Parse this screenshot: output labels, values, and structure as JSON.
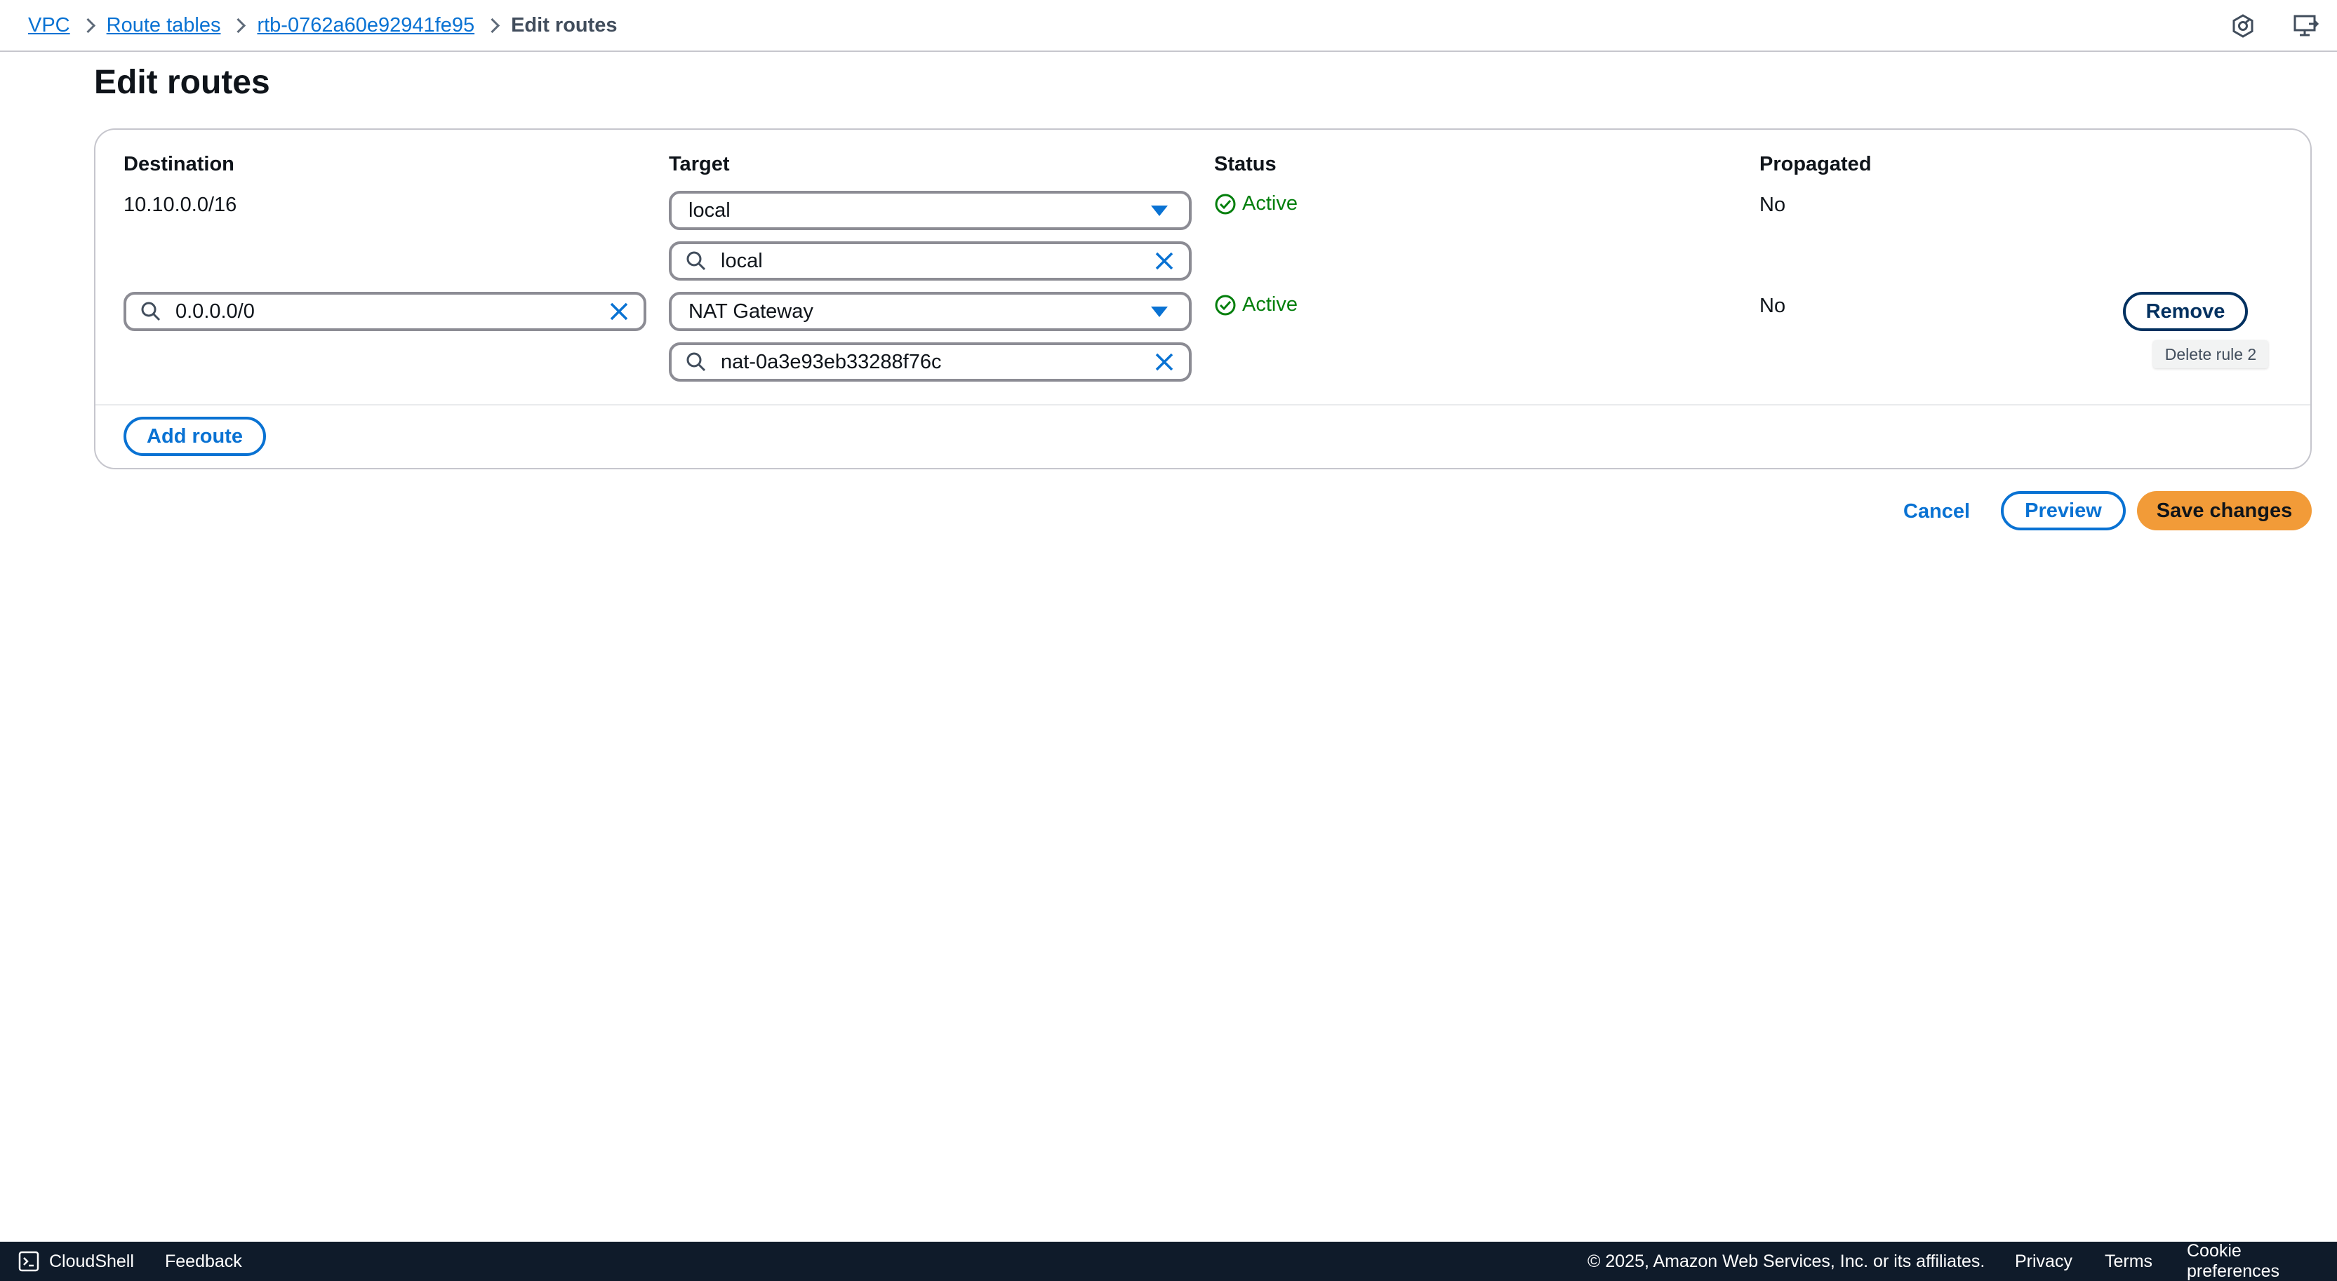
{
  "breadcrumb": {
    "items": [
      "VPC",
      "Route tables",
      "rtb-0762a60e92941fe95"
    ],
    "current": "Edit routes"
  },
  "top_icons": [
    "hexagon-settings-icon",
    "screen-share-icon"
  ],
  "page": {
    "title": "Edit routes"
  },
  "table": {
    "headers": {
      "destination": "Destination",
      "target": "Target",
      "status": "Status",
      "propagated": "Propagated"
    },
    "rows": [
      {
        "destination": "10.10.0.0/16",
        "target_type": "local",
        "target_search": "local",
        "status": "Active",
        "propagated": "No"
      },
      {
        "destination": "0.0.0.0/0",
        "target_type": "NAT Gateway",
        "target_search": "nat-0a3e93eb33288f76c",
        "status": "Active",
        "propagated": "No",
        "remove_label": "Remove",
        "tooltip": "Delete rule 2"
      }
    ],
    "add_route_label": "Add route"
  },
  "actions": {
    "cancel": "Cancel",
    "preview": "Preview",
    "save": "Save changes"
  },
  "footer": {
    "cloudshell": "CloudShell",
    "feedback": "Feedback",
    "copyright": "© 2025, Amazon Web Services, Inc. or its affiliates.",
    "privacy": "Privacy",
    "terms": "Terms",
    "cookies": "Cookie preferences"
  },
  "colors": {
    "link": "#0972d3",
    "active": "#037f0c",
    "primary": "#f29b38",
    "footer_bg": "#0f1b2a"
  }
}
